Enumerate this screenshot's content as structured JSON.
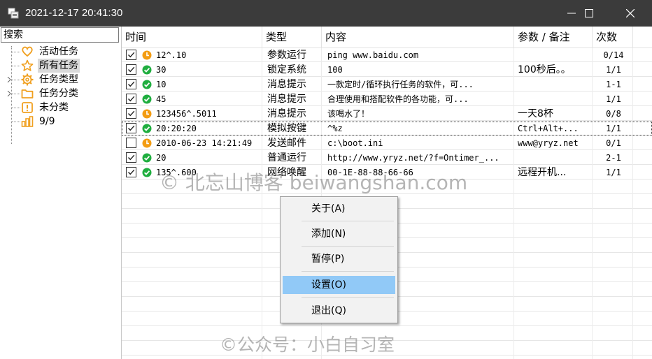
{
  "window": {
    "title": "2021-12-17 20:41:30",
    "controls": [
      "minimize-icon",
      "maximize-icon",
      "close-icon"
    ]
  },
  "sidebar": {
    "search_label": "搜索",
    "tree": [
      {
        "label": "活动任务",
        "icon": "heart-icon"
      },
      {
        "label": "所有任务",
        "icon": "star-icon",
        "selected": true
      },
      {
        "label": "任务类型",
        "icon": "gear-icon",
        "expandable": true
      },
      {
        "label": "任务分类",
        "icon": "folder-icon",
        "expandable": true
      },
      {
        "label": "未分类",
        "icon": "exclamation-icon"
      },
      {
        "label": "9/9",
        "icon": "bar-chart-icon"
      }
    ]
  },
  "table": {
    "columns": [
      "时间",
      "类型",
      "内容",
      "参数 / 备注",
      "次数"
    ],
    "rows": [
      {
        "checked": true,
        "status": "clock",
        "time": "12^.10",
        "type": "参数运行",
        "content": "ping www.baidu.com",
        "param": "",
        "count": "0/14"
      },
      {
        "checked": true,
        "status": "ok",
        "time": "30",
        "type": "锁定系统",
        "content": "100",
        "param": "100秒后。。",
        "count": "1/1"
      },
      {
        "checked": true,
        "status": "ok",
        "time": "10",
        "type": "消息提示",
        "content": "一款定时/循环执行任务的软件，可...",
        "param": "",
        "count": "1-1"
      },
      {
        "checked": true,
        "status": "ok",
        "time": "45",
        "type": "消息提示",
        "content": "合理使用和搭配软件的各功能，可...",
        "param": "",
        "count": "1/1"
      },
      {
        "checked": true,
        "status": "clock",
        "time": "123456^.5011",
        "type": "消息提示",
        "content": "该喝水了！",
        "param": "一天8杯",
        "count": "0/8"
      },
      {
        "checked": true,
        "status": "ok",
        "time": "20:20:20",
        "type": "模拟按键",
        "content": "^%z",
        "param": "Ctrl+Alt+...",
        "count": "1/1",
        "focused": true
      },
      {
        "checked": false,
        "status": "clock",
        "time": "2010-06-23 14:21:49",
        "type": "发送邮件",
        "content": "c:\\boot.ini",
        "param": "www@yryz.net",
        "count": "0/1"
      },
      {
        "checked": true,
        "status": "ok",
        "time": "20",
        "type": "普通运行",
        "content": "http://www.yryz.net/?f=Ontimer_...",
        "param": "",
        "count": "2-1"
      },
      {
        "checked": true,
        "status": "ok",
        "time": "135^.600",
        "type": "网络唤醒",
        "content": "00-1E-88-88-66-66",
        "param": "远程开机...",
        "count": "1/1"
      }
    ]
  },
  "context_menu": {
    "items": [
      "关于(A)",
      "添加(N)",
      "暂停(P)",
      "设置(O)",
      "退出(Q)"
    ],
    "highlighted": "设置(O)"
  },
  "watermarks": {
    "center": "© 北忘山博客 beiwangshan.com",
    "bottom": "©公众号：小白自习室"
  },
  "colors": {
    "titlebar": "#3b3b3b",
    "menu_highlight": "#91c9f7",
    "status_ok": "#1fae3f",
    "status_clock": "#f39c12",
    "tree_icon": "#f0a020"
  }
}
